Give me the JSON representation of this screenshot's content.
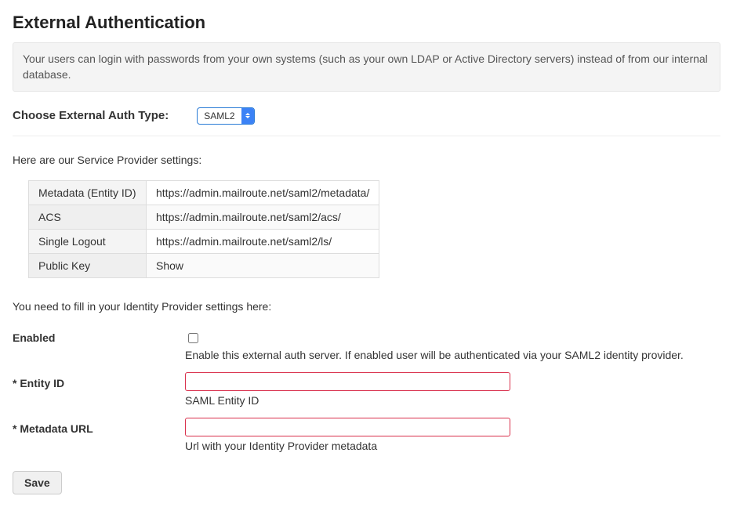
{
  "header": {
    "title": "External Authentication",
    "description": "Your users can login with passwords from your own systems (such as your own LDAP or Active Directory servers) instead of from our internal database."
  },
  "auth_type": {
    "label": "Choose External Auth Type:",
    "selected": "SAML2"
  },
  "sp": {
    "intro": "Here are our Service Provider settings:",
    "rows": [
      {
        "label": "Metadata (Entity ID)",
        "value": "https://admin.mailroute.net/saml2/metadata/"
      },
      {
        "label": "ACS",
        "value": "https://admin.mailroute.net/saml2/acs/"
      },
      {
        "label": "Single Logout",
        "value": "https://admin.mailroute.net/saml2/ls/"
      },
      {
        "label": "Public Key",
        "value": "Show"
      }
    ]
  },
  "idp": {
    "intro": "You need to fill in your Identity Provider settings here:",
    "enabled": {
      "label": "Enabled",
      "help": "Enable this external auth server. If enabled user will be authenticated via your SAML2 identity provider."
    },
    "entity_id": {
      "label": "* Entity ID",
      "value": "",
      "help": "SAML Entity ID"
    },
    "metadata_url": {
      "label": "* Metadata URL",
      "value": "",
      "help": "Url with your Identity Provider metadata"
    }
  },
  "actions": {
    "save": "Save"
  }
}
